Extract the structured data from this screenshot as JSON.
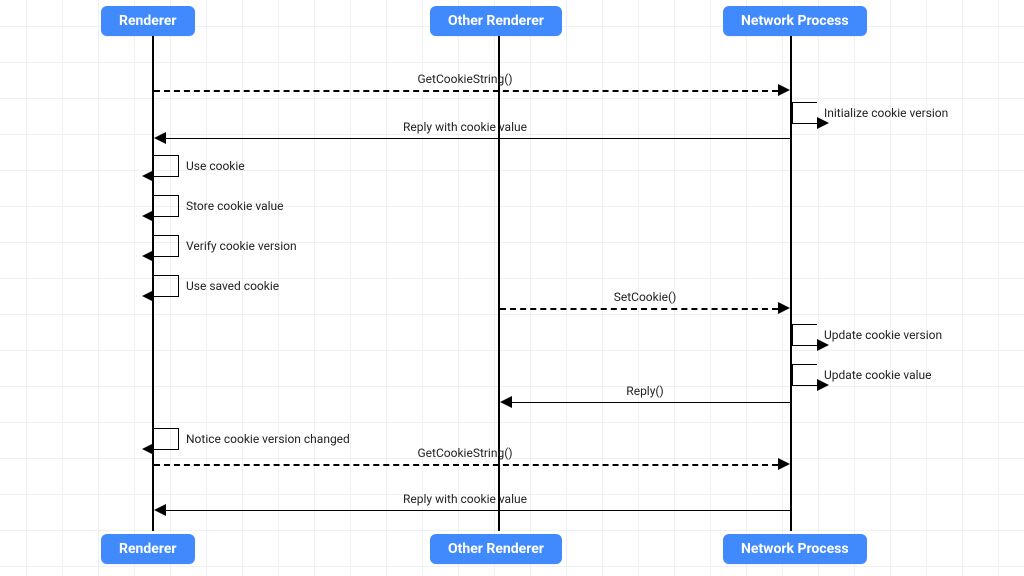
{
  "lanes": {
    "renderer": "Renderer",
    "other": "Other Renderer",
    "network": "Network Process"
  },
  "messages": {
    "m1": "GetCookieString()",
    "m2": "Reply with cookie value",
    "m3": "SetCookie()",
    "m4": "Reply()",
    "m5": "GetCookieString()",
    "m6": "Reply with cookie value"
  },
  "self": {
    "s_init": "Initialize cookie version",
    "s_use": "Use cookie",
    "s_store": "Store cookie value",
    "s_verify": "Verify cookie version",
    "s_saved": "Use saved cookie",
    "s_upd_ver": "Update cookie version",
    "s_upd_val": "Update cookie value",
    "s_notice": "Notice cookie version changed"
  },
  "colors": {
    "accent": "#418afd"
  }
}
